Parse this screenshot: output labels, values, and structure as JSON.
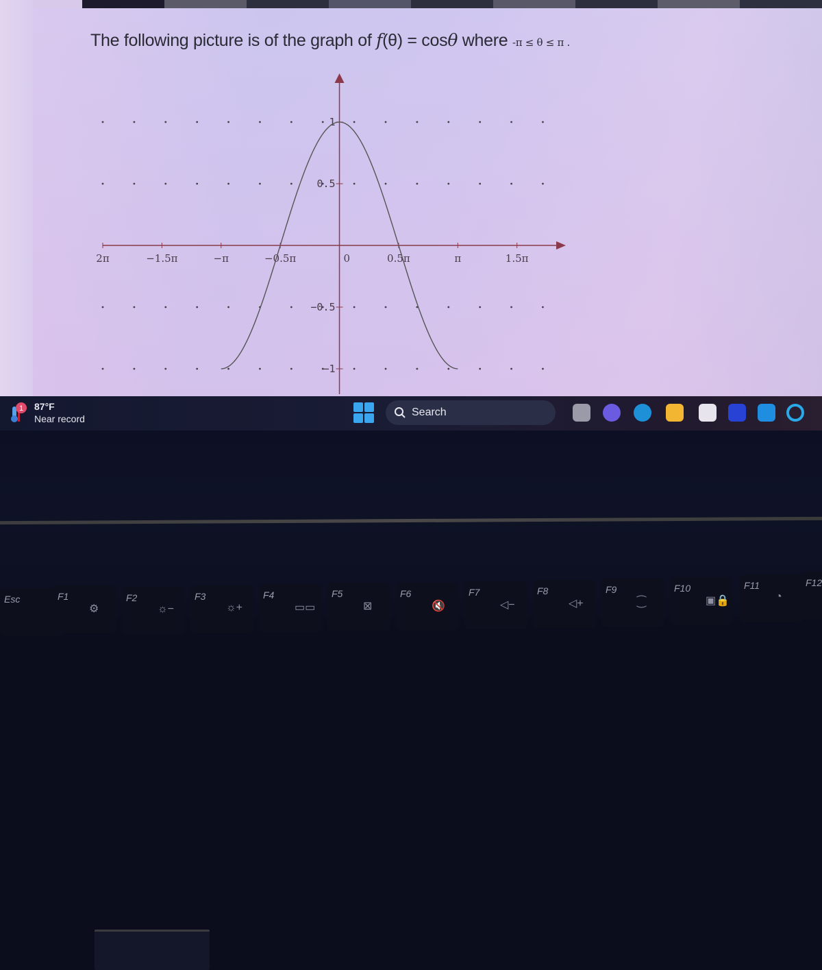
{
  "question": {
    "prefix": "The following picture is of the graph of ",
    "func_name": "f",
    "func_arg": "(θ)",
    "equals": " = cos",
    "theta": "θ",
    "where": " where ",
    "domain_left": "-π ≤ θ ≤ π ."
  },
  "chart_data": {
    "type": "line",
    "title": "",
    "function": "cos(theta)",
    "xlabel": "",
    "ylabel": "",
    "x_domain_plotted": [
      "-π",
      "π"
    ],
    "xlim": [
      -6.283,
      5.9
    ],
    "ylim": [
      -1.15,
      1.35
    ],
    "x_ticks": [
      {
        "value": -6.283,
        "label": "2π"
      },
      {
        "value": -4.712,
        "label": "−1.5π"
      },
      {
        "value": -3.1416,
        "label": "−π"
      },
      {
        "value": -1.5708,
        "label": "−0.5π"
      },
      {
        "value": 0,
        "label": "0"
      },
      {
        "value": 1.5708,
        "label": "0.5π"
      },
      {
        "value": 3.1416,
        "label": "π"
      },
      {
        "value": 4.712,
        "label": "1.5π"
      }
    ],
    "y_ticks": [
      {
        "value": 1,
        "label": "1"
      },
      {
        "value": 0.5,
        "label": "0.5"
      },
      {
        "value": -0.5,
        "label": "−0.5"
      },
      {
        "value": -1,
        "label": "−1"
      }
    ],
    "grid": "dotted",
    "grid_rows": [
      1,
      0.5,
      -0.5,
      -1
    ],
    "series": [
      {
        "name": "f(θ) = cos θ",
        "x": [
          -3.1416,
          -2.7489,
          -2.3562,
          -1.9635,
          -1.5708,
          -1.1781,
          -0.7854,
          -0.3927,
          0,
          0.3927,
          0.7854,
          1.1781,
          1.5708,
          1.9635,
          2.3562,
          2.7489,
          3.1416
        ],
        "y": [
          -1,
          -0.924,
          -0.707,
          -0.383,
          0,
          0.383,
          0.707,
          0.924,
          1,
          0.924,
          0.707,
          0.383,
          0,
          -0.383,
          -0.707,
          -0.924,
          -1
        ],
        "color": "#555555"
      }
    ],
    "axis_color": "#8a3a4a"
  },
  "taskbar": {
    "weather": {
      "badge": "1",
      "temp": "87°F",
      "desc": "Near record"
    },
    "search_label": "Search",
    "apps": [
      {
        "name": "task-view-icon",
        "color": "#9a9aa8"
      },
      {
        "name": "teams-meet-icon",
        "color": "#6b5be0"
      },
      {
        "name": "edge-icon",
        "color": "#1e90d8"
      },
      {
        "name": "file-explorer-icon",
        "color": "#f2b632"
      },
      {
        "name": "microsoft-store-icon",
        "color": "#e8e4ee"
      },
      {
        "name": "search-app-icon",
        "color": "#2842d6"
      },
      {
        "name": "mail-icon",
        "color": "#1f8ee0"
      },
      {
        "name": "cortana-icon",
        "color": "#2aa8e8"
      }
    ]
  },
  "keyboard": {
    "keys": [
      {
        "label": "Esc",
        "icon": ""
      },
      {
        "label": "F1",
        "icon": "⚙"
      },
      {
        "label": "F2",
        "icon": "☼−"
      },
      {
        "label": "F3",
        "icon": "☼+"
      },
      {
        "label": "F4",
        "icon": "▭▭"
      },
      {
        "label": "F5",
        "icon": "⊠"
      },
      {
        "label": "F6",
        "icon": "🔇"
      },
      {
        "label": "F7",
        "icon": "◁−"
      },
      {
        "label": "F8",
        "icon": "◁+"
      },
      {
        "label": "F9",
        "icon": "⁐"
      },
      {
        "label": "F10",
        "icon": "▣🔒"
      },
      {
        "label": "F11",
        "icon": "◔"
      },
      {
        "label": "F12",
        "icon": ""
      }
    ]
  }
}
